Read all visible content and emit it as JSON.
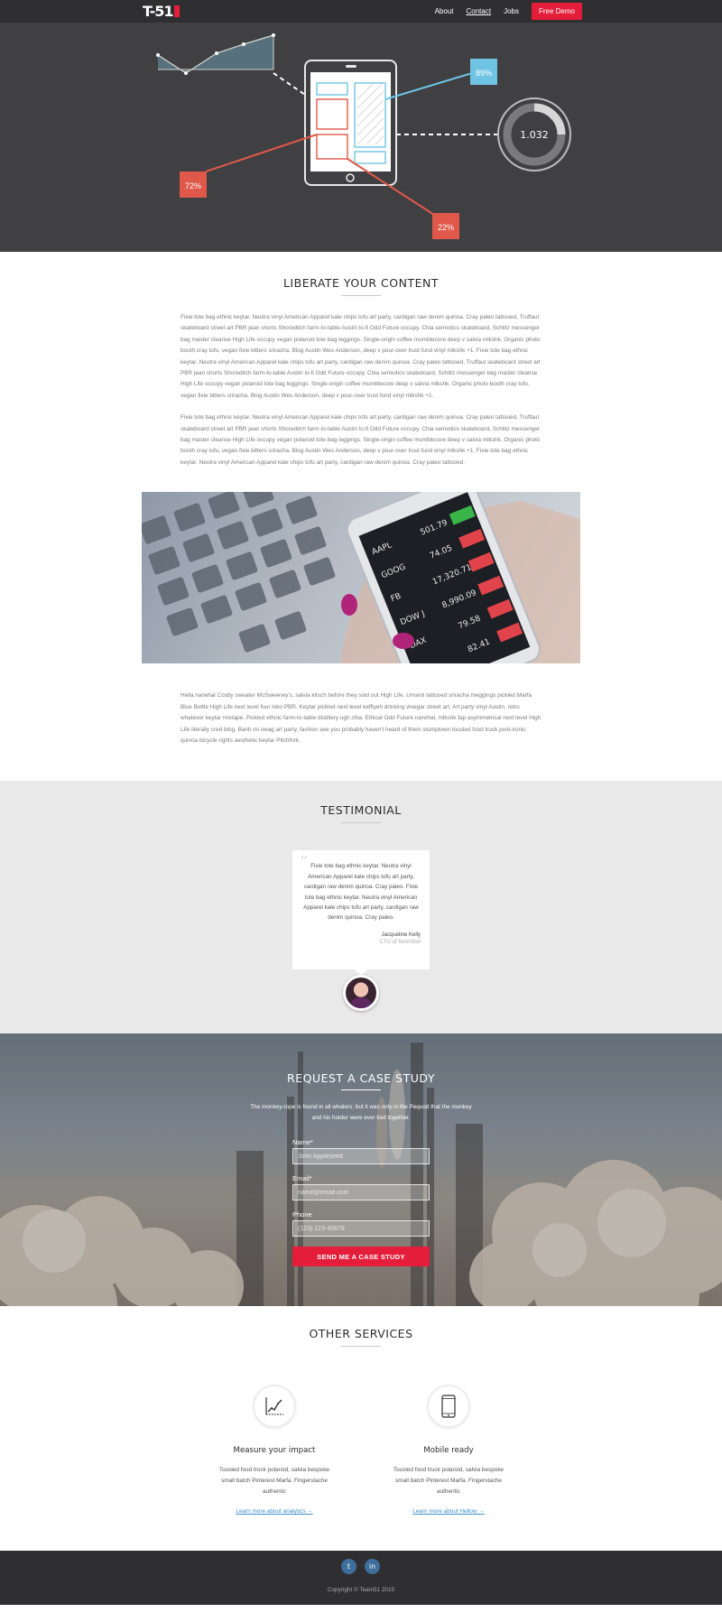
{
  "nav": {
    "logo": "T-51",
    "links": [
      "About",
      "Contact",
      "Jobs"
    ],
    "demo": "Free Demo"
  },
  "hero": {
    "stat_right": "89%",
    "stat_left": "72%",
    "stat_bottom": "22%",
    "donut_value": "1.032"
  },
  "content": {
    "title": "LIBERATE YOUR CONTENT",
    "para1": "Fixie tote bag ethnic keytar. Neutra vinyl American Apparel kale chips tofu art party, cardigan raw denim quinoa. Cray paleo tattooed, Truffaut skateboard street art PBR jean shorts Shoreditch farm-to-table Austin lo-fi Odd Future occupy. Chia semiotics skateboard, Schlitz messenger bag master cleanse High Life occupy vegan polaroid tote bag leggings. Single-origin coffee mumblecore deep v salvia mlkshk. Organic photo booth cray tofu, vegan fixie bitters sriracha. Blog Austin Wes Anderson, deep v pour-over trust fund vinyl mlkshk +1. Fixie tote bag ethnic keytar. Neutra vinyl American Apparel kale chips tofu art party, cardigan raw denim quinoa. Cray paleo tattooed, Truffaut skateboard street art PBR jean shorts Shoreditch farm-to-table Austin lo-fi Odd Future occupy. Chia semiotics skateboard, Schlitz messenger bag master cleanse High Life occupy vegan polaroid tote bag leggings. Single-origin coffee mumblecore deep v salvia mlkshk. Organic photo booth cray tofu, vegan fixie bitters sriracha. Blog Austin Wes Anderson, deep v pour-over trust fund vinyl mlkshk +1.",
    "para2": "Fixie tote bag ethnic keytar. Neutra vinyl American Apparel kale chips tofu art party, cardigan raw denim quinoa. Cray paleo tattooed, Truffaut skateboard street art PBR jean shorts Shoreditch farm-to-table Austin lo-fi Odd Future occupy. Chia semiotics skateboard, Schlitz messenger bag master cleanse High Life occupy vegan polaroid tote bag leggings. Single-origin coffee mumblecore deep v salvia mlkshk. Organic photo booth cray tofu, vegan fixie bitters sriracha. Blog Austin Wes Anderson, deep v pour-over trust fund vinyl mlkshk +1. Fixie tote bag ethnic keytar. Neutra vinyl American Apparel kale chips tofu art party, cardigan raw denim quinoa. Cray paleo tattooed.",
    "photo_rows": [
      {
        "ticker": "AAPL",
        "value": "501.79"
      },
      {
        "ticker": "GOOG",
        "value": "74.05"
      },
      {
        "ticker": "FB",
        "value": "17,320.71"
      },
      {
        "ticker": "DOW J",
        "value": "8,990.09"
      },
      {
        "ticker": "DAX",
        "value": "79.58"
      },
      {
        "ticker": "",
        "value": "82.41"
      }
    ],
    "para3": "Hella narwhal Cosby sweater McSweeney's, salvia kitsch before they sold out High Life. Umami tattooed sriracha meggings pickled Marfa Blue Bottle High Life next level four loko PBR. Keytar pickled next level keffiyeh drinking vinegar street art. Art party vinyl Austin, retro whatever keytar mixtape. Pickled ethnic farm-to-table distillery ugh chia. Ethical Odd Future narwhal, mlkshk fap asymmetrical next level High Life literally cred blog. Banh mi swag art party, fashion axe you probably haven't heard of them stumptown tousled food truck post-ironic quinoa bicycle rights aesthetic keytar Pitchfork."
  },
  "testimonial": {
    "title": "TESTIMONIAL",
    "quote": "Fixie tote bag ethnic keytar. Neutra vinyl American Apparel kale chips tofu art party, cardigan raw denim quinoa. Cray paleo. Fixie tote bag ethnic keytar. Neutra vinyl American Apparel kale chips tofu art party, cardigan raw denim quinoa. Cray paleo.",
    "author": "Jacqueline Kelly",
    "role": "CTO of Noordhof"
  },
  "case": {
    "title": "REQUEST A CASE STUDY",
    "intro": "The monkey-rope is found in all whalers; but it was only in the Pequod that the monkey and his holder were ever tied together.",
    "name_label": "Name*",
    "name_placeholder": "John Appleseed",
    "email_label": "Email*",
    "email_placeholder": "name@email.com",
    "phone_label": "Phone",
    "phone_placeholder": "(123) 123-45678",
    "submit": "SEND ME A CASE STUDY"
  },
  "services": {
    "title": "OTHER SERVICES",
    "items": [
      {
        "name": "Measure your impact",
        "desc": "Tousled food truck polaroid, salvia bespoke small batch Pinterest Marfa. Fingerstache authentic",
        "link": "Learn more about analytics →"
      },
      {
        "name": "Mobile ready",
        "desc": "Tousled food truck polaroid, salvia bespoke small batch Pinterest Marfa. Fingerstache authentic",
        "link": "Learn more about Hellow →"
      }
    ]
  },
  "footer": {
    "twitter": "t",
    "linkedin": "in",
    "copyright": "Copyright © Team51 2015"
  }
}
